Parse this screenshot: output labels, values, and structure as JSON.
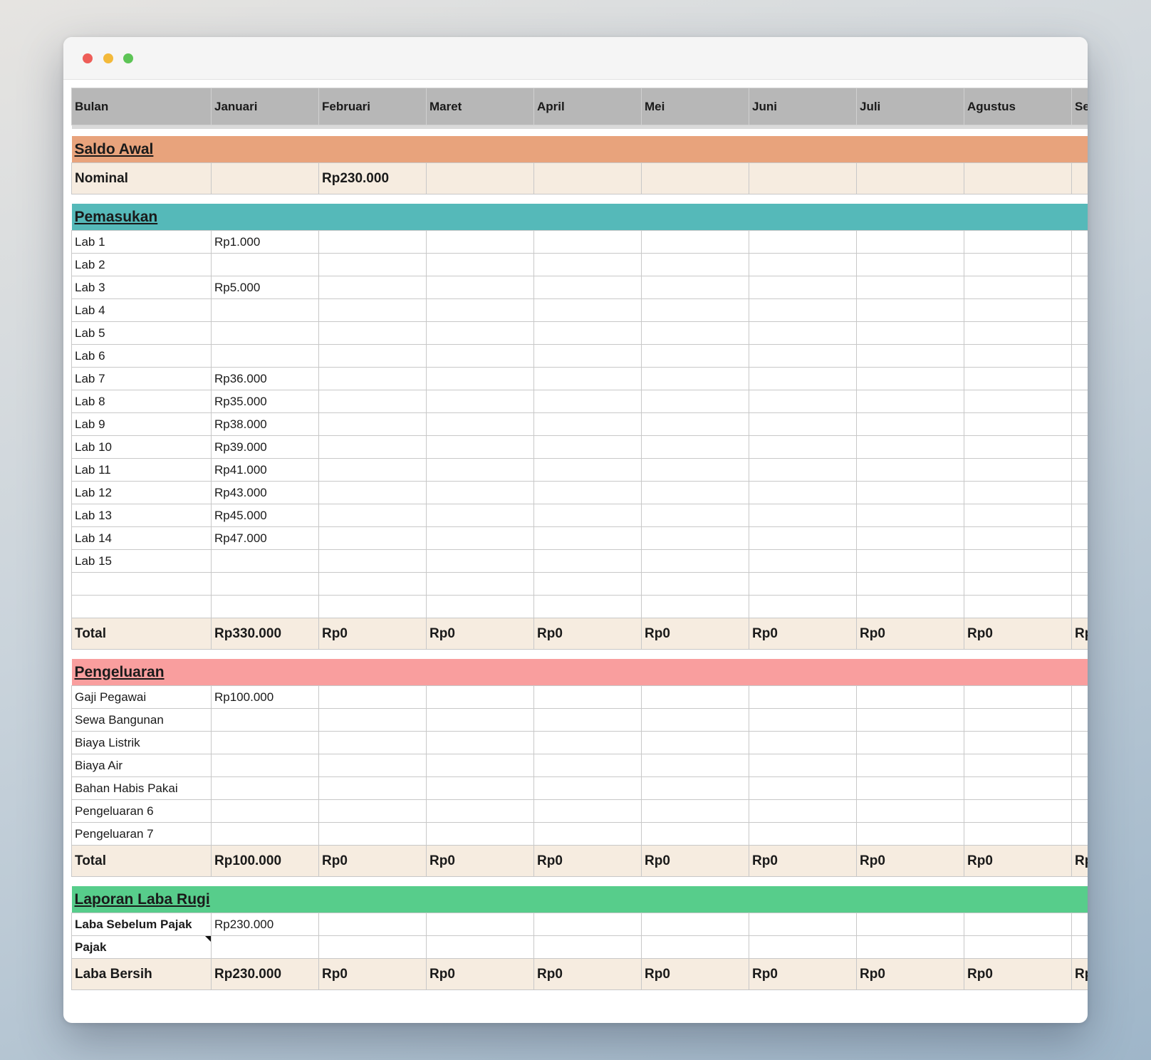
{
  "window": {
    "controls": [
      "close",
      "minimize",
      "maximize"
    ]
  },
  "header": {
    "label": "Bulan",
    "months": [
      "Januari",
      "Februari",
      "Maret",
      "April",
      "Mei",
      "Juni",
      "Juli",
      "Agustus",
      "Se"
    ]
  },
  "saldo": {
    "title": "Saldo Awal",
    "row_label": "Nominal",
    "values": [
      "",
      "Rp230.000",
      "",
      "",
      "",
      "",
      "",
      "",
      ""
    ]
  },
  "pemasukan": {
    "title": "Pemasukan",
    "rows": [
      {
        "label": "Lab 1",
        "values": [
          "Rp1.000",
          "",
          "",
          "",
          "",
          "",
          "",
          "",
          ""
        ]
      },
      {
        "label": "Lab 2",
        "values": [
          "",
          "",
          "",
          "",
          "",
          "",
          "",
          "",
          ""
        ]
      },
      {
        "label": "Lab 3",
        "values": [
          "Rp5.000",
          "",
          "",
          "",
          "",
          "",
          "",
          "",
          ""
        ]
      },
      {
        "label": "Lab 4",
        "values": [
          "",
          "",
          "",
          "",
          "",
          "",
          "",
          "",
          ""
        ]
      },
      {
        "label": "Lab 5",
        "values": [
          "",
          "",
          "",
          "",
          "",
          "",
          "",
          "",
          ""
        ]
      },
      {
        "label": "Lab 6",
        "values": [
          "",
          "",
          "",
          "",
          "",
          "",
          "",
          "",
          ""
        ]
      },
      {
        "label": "Lab 7",
        "values": [
          "Rp36.000",
          "",
          "",
          "",
          "",
          "",
          "",
          "",
          ""
        ]
      },
      {
        "label": "Lab 8",
        "values": [
          "Rp35.000",
          "",
          "",
          "",
          "",
          "",
          "",
          "",
          ""
        ]
      },
      {
        "label": "Lab 9",
        "values": [
          "Rp38.000",
          "",
          "",
          "",
          "",
          "",
          "",
          "",
          ""
        ]
      },
      {
        "label": "Lab 10",
        "values": [
          "Rp39.000",
          "",
          "",
          "",
          "",
          "",
          "",
          "",
          ""
        ]
      },
      {
        "label": "Lab 11",
        "values": [
          "Rp41.000",
          "",
          "",
          "",
          "",
          "",
          "",
          "",
          ""
        ]
      },
      {
        "label": "Lab 12",
        "values": [
          "Rp43.000",
          "",
          "",
          "",
          "",
          "",
          "",
          "",
          ""
        ]
      },
      {
        "label": "Lab 13",
        "values": [
          "Rp45.000",
          "",
          "",
          "",
          "",
          "",
          "",
          "",
          ""
        ]
      },
      {
        "label": "Lab 14",
        "values": [
          "Rp47.000",
          "",
          "",
          "",
          "",
          "",
          "",
          "",
          ""
        ]
      },
      {
        "label": "Lab 15",
        "values": [
          "",
          "",
          "",
          "",
          "",
          "",
          "",
          "",
          ""
        ]
      },
      {
        "label": "",
        "values": [
          "",
          "",
          "",
          "",
          "",
          "",
          "",
          "",
          ""
        ]
      },
      {
        "label": "",
        "values": [
          "",
          "",
          "",
          "",
          "",
          "",
          "",
          "",
          ""
        ]
      }
    ],
    "total": {
      "label": "Total",
      "values": [
        "Rp330.000",
        "Rp0",
        "Rp0",
        "Rp0",
        "Rp0",
        "Rp0",
        "Rp0",
        "Rp0",
        "Rp"
      ]
    }
  },
  "pengeluaran": {
    "title": "Pengeluaran",
    "rows": [
      {
        "label": "Gaji Pegawai",
        "values": [
          "Rp100.000",
          "",
          "",
          "",
          "",
          "",
          "",
          "",
          ""
        ]
      },
      {
        "label": "Sewa Bangunan",
        "values": [
          "",
          "",
          "",
          "",
          "",
          "",
          "",
          "",
          ""
        ]
      },
      {
        "label": "Biaya Listrik",
        "values": [
          "",
          "",
          "",
          "",
          "",
          "",
          "",
          "",
          ""
        ]
      },
      {
        "label": "Biaya Air",
        "values": [
          "",
          "",
          "",
          "",
          "",
          "",
          "",
          "",
          ""
        ]
      },
      {
        "label": "Bahan Habis Pakai",
        "values": [
          "",
          "",
          "",
          "",
          "",
          "",
          "",
          "",
          ""
        ]
      },
      {
        "label": "Pengeluaran 6",
        "values": [
          "",
          "",
          "",
          "",
          "",
          "",
          "",
          "",
          ""
        ]
      },
      {
        "label": "Pengeluaran 7",
        "values": [
          "",
          "",
          "",
          "",
          "",
          "",
          "",
          "",
          ""
        ]
      }
    ],
    "total": {
      "label": "Total",
      "values": [
        "Rp100.000",
        "Rp0",
        "Rp0",
        "Rp0",
        "Rp0",
        "Rp0",
        "Rp0",
        "Rp0",
        "Rp"
      ]
    }
  },
  "laporan": {
    "title": "Laporan Laba Rugi",
    "rows": [
      {
        "label": "Laba Sebelum Pajak",
        "values": [
          "Rp230.000",
          "",
          "",
          "",
          "",
          "",
          "",
          "",
          ""
        ]
      },
      {
        "label": "Pajak",
        "values": [
          "",
          "",
          "",
          "",
          "",
          "",
          "",
          "",
          ""
        ],
        "has_note": true
      }
    ],
    "bersih": {
      "label": "Laba Bersih",
      "values": [
        "Rp230.000",
        "Rp0",
        "Rp0",
        "Rp0",
        "Rp0",
        "Rp0",
        "Rp0",
        "Rp0",
        "Rp"
      ]
    }
  },
  "colors": {
    "saldo_header": "#e8a37c",
    "pemasukan_header": "#55b9b9",
    "pengeluaran_header": "#f99e9e",
    "laporan_header": "#57cd8b",
    "total_row": "#f6ece0",
    "column_header": "#b7b7b7"
  }
}
